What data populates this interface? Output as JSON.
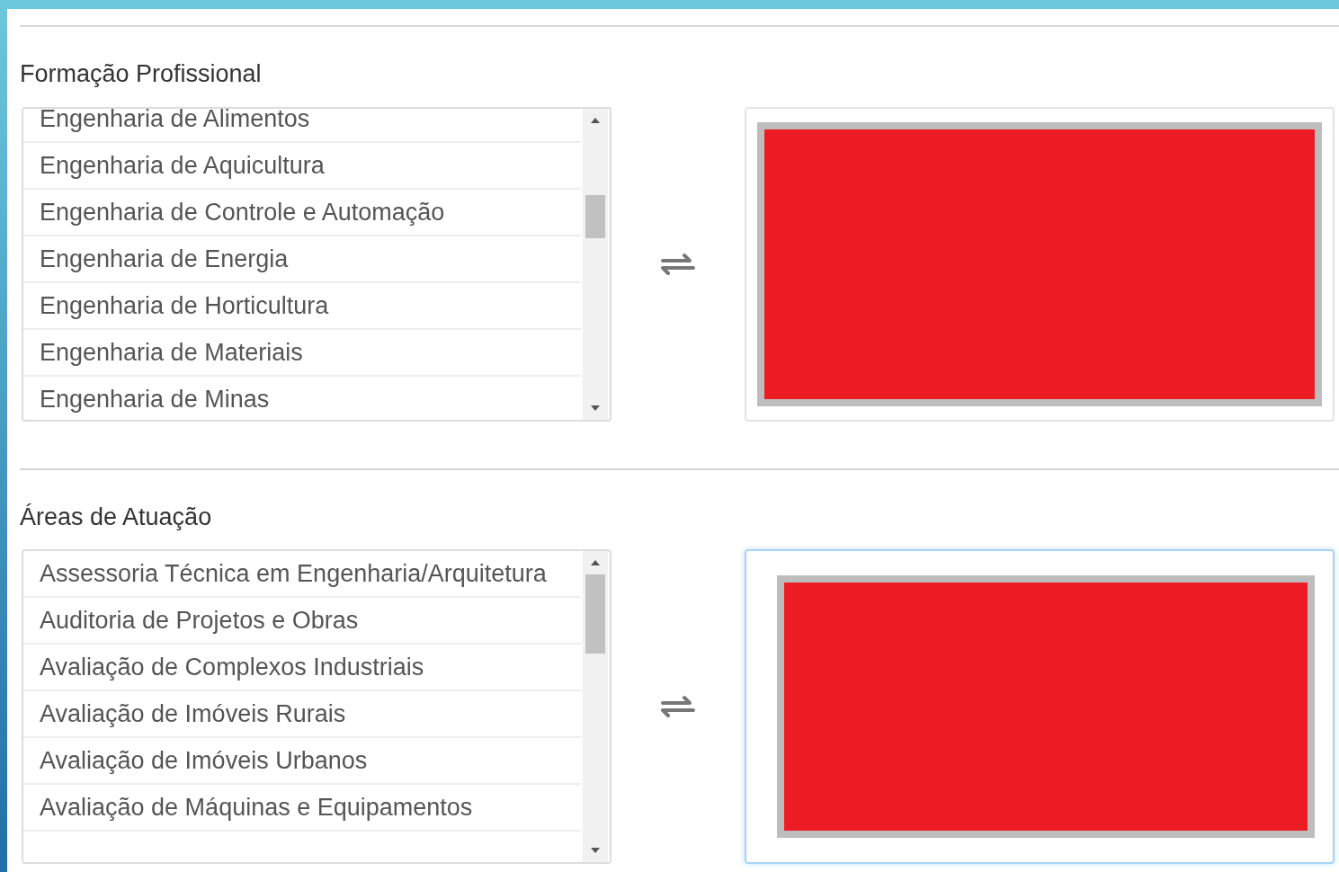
{
  "sections": [
    {
      "label": "Formação Profissional",
      "focused": false,
      "options": [
        "Engenharia de Alimentos",
        "Engenharia de Aquicultura",
        "Engenharia de Controle e Automação",
        "Engenharia de Energia",
        "Engenharia de Horticultura",
        "Engenharia de Materiais",
        "Engenharia de Minas"
      ]
    },
    {
      "label": "Áreas de Atuação",
      "focused": true,
      "options": [
        "Assessoria Técnica em Engenharia/Arquitetura",
        "Auditoria de Projetos e Obras",
        "Avaliação de Complexos Industriais",
        "Avaliação de Imóveis Rurais",
        "Avaliação de Imóveis Urbanos",
        "Avaliação de Máquinas e Equipamentos"
      ]
    }
  ]
}
